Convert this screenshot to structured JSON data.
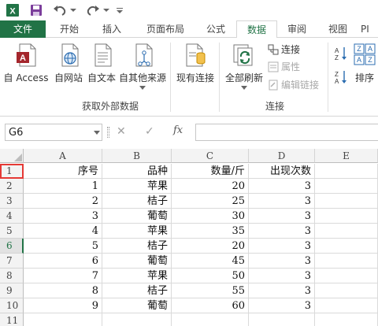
{
  "window": {
    "app_icon": "excel-icon",
    "quick_access": [
      "save-icon",
      "undo-icon",
      "redo-icon",
      "customize-icon"
    ]
  },
  "tabs": [
    {
      "label": "文件"
    },
    {
      "label": "开始"
    },
    {
      "label": "插入"
    },
    {
      "label": "页面布局"
    },
    {
      "label": "公式"
    },
    {
      "label": "数据"
    },
    {
      "label": "审阅"
    },
    {
      "label": "视图"
    },
    {
      "label": "PI"
    }
  ],
  "ribbon": {
    "external_group": {
      "label": "获取外部数据",
      "buttons": [
        "自 Access",
        "自网站",
        "自文本",
        "自其他来源"
      ]
    },
    "existing_connections": "现有连接",
    "refresh_all": "全部刷新",
    "connections_group": {
      "label": "连接",
      "items": [
        {
          "label": "连接",
          "enabled": true
        },
        {
          "label": "属性",
          "enabled": false
        },
        {
          "label": "编辑链接",
          "enabled": false
        }
      ]
    },
    "sort_label": "排序"
  },
  "formula_bar": {
    "name_box": "G6",
    "cancel_glyph": "✕",
    "enter_glyph": "✓",
    "fx_glyph": "fx",
    "formula": ""
  },
  "grid": {
    "columns": [
      "A",
      "B",
      "C",
      "D",
      "E"
    ],
    "header_row": [
      "序号",
      "品种",
      "数量/斤",
      "出现次数",
      ""
    ],
    "rows": [
      [
        "1",
        "苹果",
        "20",
        "3",
        ""
      ],
      [
        "2",
        "桔子",
        "25",
        "3",
        ""
      ],
      [
        "3",
        "葡萄",
        "30",
        "3",
        ""
      ],
      [
        "4",
        "苹果",
        "35",
        "3",
        ""
      ],
      [
        "5",
        "桔子",
        "20",
        "3",
        ""
      ],
      [
        "6",
        "葡萄",
        "45",
        "3",
        ""
      ],
      [
        "7",
        "苹果",
        "50",
        "3",
        ""
      ],
      [
        "8",
        "桔子",
        "55",
        "3",
        ""
      ],
      [
        "9",
        "葡萄",
        "60",
        "3",
        ""
      ]
    ],
    "row_numbers": [
      "1",
      "2",
      "3",
      "4",
      "5",
      "6",
      "7",
      "8",
      "9",
      "10",
      "11"
    ],
    "selected_row": "6",
    "highlighted_row_header": "1"
  },
  "colors": {
    "excel_green": "#217346",
    "highlight_red": "#e53935"
  }
}
